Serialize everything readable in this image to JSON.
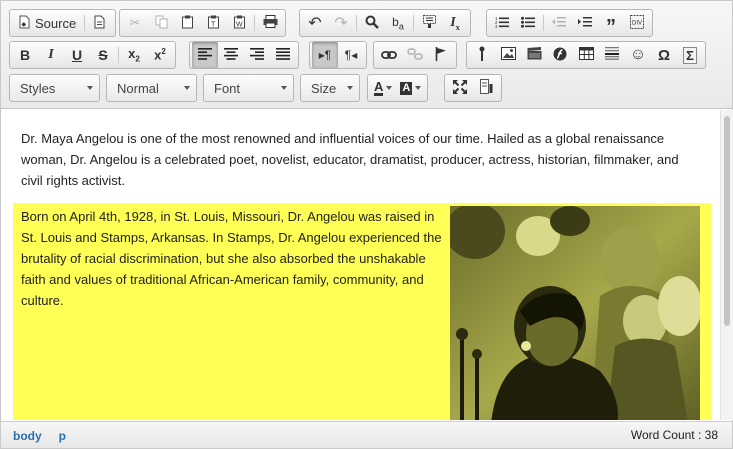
{
  "toolbar": {
    "source_label": "Source",
    "styles_label": "Styles",
    "format_label": "Normal",
    "font_label": "Font",
    "size_label": "Size",
    "text_color_label": "A",
    "bg_color_label": "A",
    "bold_label": "B",
    "italic_label": "I",
    "underline_label": "U",
    "strike_label": "S",
    "clear_format_label": "I",
    "omega_label": "Ω",
    "sigma_label": "Σ"
  },
  "content": {
    "paragraph1": "Dr. Maya Angelou is one of the most renowned and influential voices of our time. Hailed as a global renaissance woman, Dr. Angelou is a celebrated poet, novelist, educator, dramatist, producer, actress, historian, filmmaker, and civil rights activist.",
    "paragraph2": "Born on April 4th, 1928, in St. Louis, Missouri, Dr. Angelou was raised in St. Louis and Stamps, Arkansas. In Stamps, Dr. Angelou experienced the brutality of racial discrimination, but she also absorbed the unshakable faith and values of traditional African-American family, community, and culture.",
    "highlight_color": "#ffff55"
  },
  "statusbar": {
    "path": [
      "body",
      "p"
    ],
    "word_count": "Word Count : 38"
  }
}
